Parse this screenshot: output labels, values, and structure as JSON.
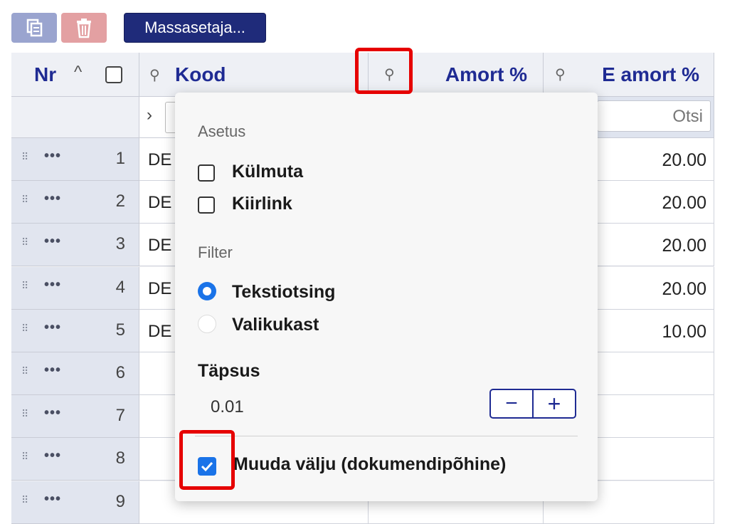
{
  "toolbar": {
    "copy_icon": "copy-icon",
    "delete_icon": "trash-icon",
    "mass_label": "Massasetaja..."
  },
  "header": {
    "nr": "Nr",
    "kood": "Kood",
    "amort": "Amort %",
    "e_amort": "E amort %"
  },
  "filter": {
    "search_placeholder": "Otsi"
  },
  "rows": [
    {
      "nr": "1",
      "kood": "DE",
      "e_amort": "20.00"
    },
    {
      "nr": "2",
      "kood": "DE",
      "e_amort": "20.00"
    },
    {
      "nr": "3",
      "kood": "DE",
      "e_amort": "20.00"
    },
    {
      "nr": "4",
      "kood": "DE",
      "e_amort": "20.00"
    },
    {
      "nr": "5",
      "kood": "DE",
      "e_amort": "10.00"
    },
    {
      "nr": "6",
      "kood": "",
      "e_amort": ""
    },
    {
      "nr": "7",
      "kood": "",
      "e_amort": ""
    },
    {
      "nr": "8",
      "kood": "",
      "e_amort": ""
    },
    {
      "nr": "9",
      "kood": "",
      "e_amort": ""
    }
  ],
  "popup": {
    "section_asetus": "Asetus",
    "kulmuta": "Külmuta",
    "kiirlink": "Kiirlink",
    "section_filter": "Filter",
    "tekstiotsing": "Tekstiotsing",
    "valikukast": "Valikukast",
    "tapsus_label": "Täpsus",
    "tapsus_value": "0.01",
    "minus": "−",
    "plus": "+",
    "muuda": "Muuda välju (dokumendipõhine)",
    "kulmuta_checked": false,
    "kiirlink_checked": false,
    "filter_selected": "Tekstiotsing",
    "muuda_checked": true
  },
  "colors": {
    "accent": "#1f2b93",
    "highlight": "#e60000",
    "radio": "#1a73e8"
  }
}
